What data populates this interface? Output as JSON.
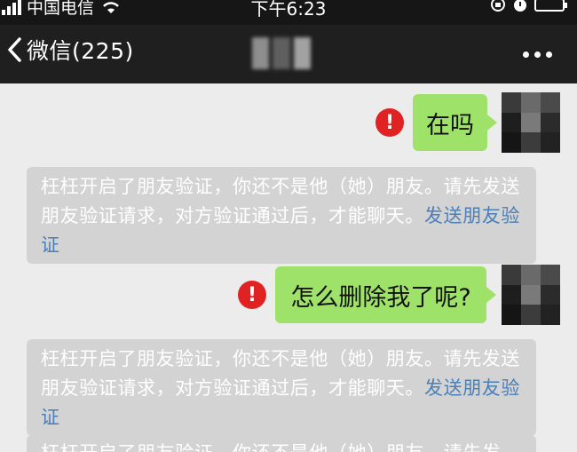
{
  "status_bar": {
    "carrier": "中国电信",
    "time": "下午6:23"
  },
  "nav": {
    "back_label": "微信(225)"
  },
  "messages": [
    {
      "text": "在吗"
    },
    {
      "text": "怎么删除我了呢?"
    }
  ],
  "notices": [
    {
      "text": "枉枉开启了朋友验证，你还不是他（她）朋友。请先发送朋友验证请求，对方验证通过后，才能聊天。",
      "link": "发送朋友验证"
    },
    {
      "text": "枉枉开启了朋友验证，你还不是他（她）朋友。请先发送朋友验证请求，对方验证通过后，才能聊天。",
      "link": "发送朋友验证"
    },
    {
      "text": "枉枉开启了朋友验证，你还不是他（她）朋友。请先发"
    }
  ],
  "icons": {
    "error": "exclamation-icon",
    "back": "chevron-left-icon",
    "more": "more-dots-icon"
  },
  "colors": {
    "bubble": "#9fe26a",
    "error": "#e02222",
    "link": "#4a7fb8",
    "notice_bg": "#d3d3d3",
    "nav_bg": "#1f1f1f"
  }
}
